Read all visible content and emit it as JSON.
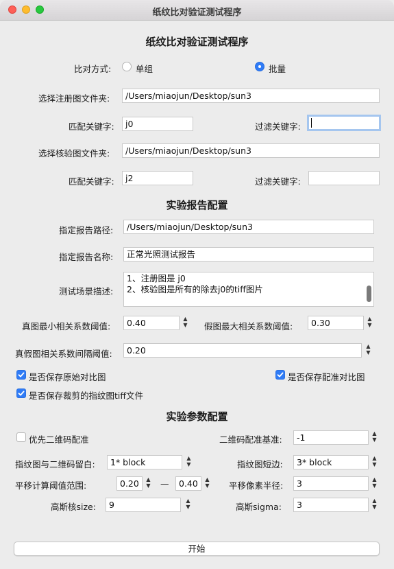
{
  "window": {
    "title": "纸纹比对验证测试程序"
  },
  "header": {
    "title": "纸纹比对验证测试程序"
  },
  "compare_mode": {
    "label": "比对方式:",
    "options": [
      "单组",
      "批量"
    ],
    "selected": "批量"
  },
  "register": {
    "folder_label": "选择注册图文件夹:",
    "folder_value": "/Users/miaojun/Desktop/sun3",
    "match_label": "匹配关键字:",
    "match_value": "j0",
    "filter_label": "过滤关键字:",
    "filter_value": ""
  },
  "verify": {
    "folder_label": "选择核验图文件夹:",
    "folder_value": "/Users/miaojun/Desktop/sun3",
    "match_label": "匹配关键字:",
    "match_value": "j2",
    "filter_label": "过滤关键字:",
    "filter_value": ""
  },
  "report": {
    "section_title": "实验报告配置",
    "path_label": "指定报告路径:",
    "path_value": "/Users/miaojun/Desktop/sun3",
    "name_label": "指定报告名称:",
    "name_value": "正常光照测试报告",
    "scene_label": "测试场景描述:",
    "scene_lines": [
      "1、注册图是  j0",
      "2、核验图是所有的除去j0的tiff图片"
    ],
    "true_min_label": "真图最小相关系数阈值:",
    "true_min_value": "0.40",
    "false_max_label": "假图最大相关系数阈值:",
    "false_max_value": "0.30",
    "gap_label": "真假图相关系数间隔阈值:",
    "gap_value": "0.20",
    "save_original_label": "是否保存原始对比图",
    "save_original": true,
    "save_aligned_label": "是否保存配准对比图",
    "save_aligned": true,
    "save_crop_label": "是否保存裁剪的指纹图tiff文件",
    "save_crop": true
  },
  "params": {
    "section_title": "实验参数配置",
    "qr_first_label": "优先二维码配准",
    "qr_first": false,
    "qr_base_label": "二维码配准基准:",
    "qr_base_value": "-1",
    "margin_label": "指纹图与二维码留白:",
    "margin_value": "1* block",
    "short_side_label": "指纹图短边:",
    "short_side_value": "3* block",
    "shift_range_label": "平移计算阈值范围:",
    "shift_min_value": "0.20",
    "range_dash": "—",
    "shift_max_value": "0.40",
    "shift_radius_label": "平移像素半径:",
    "shift_radius_value": "3",
    "gauss_size_label": "高斯核size:",
    "gauss_size_value": "9",
    "gauss_sigma_label": "高斯sigma:",
    "gauss_sigma_value": "3"
  },
  "actions": {
    "start_label": "开始"
  },
  "colors": {
    "accent": "#2f7bf6",
    "focus_ring": "#a5c6ef",
    "window_bg": "#ececec"
  }
}
